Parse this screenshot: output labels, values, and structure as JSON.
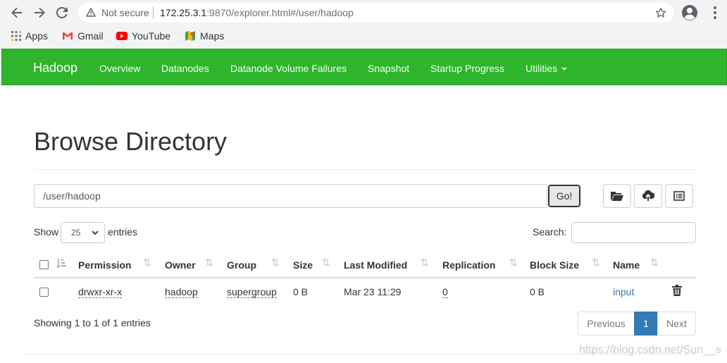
{
  "browser": {
    "security_label": "Not secure",
    "url_host": "172.25.3.1",
    "url_rest": ":9870/explorer.html#/user/hadoop",
    "bookmarks": [
      "Apps",
      "Gmail",
      "YouTube",
      "Maps"
    ]
  },
  "navbar": {
    "brand": "Hadoop",
    "items": [
      "Overview",
      "Datanodes",
      "Datanode Volume Failures",
      "Snapshot",
      "Startup Progress",
      "Utilities"
    ],
    "color": "#2fb52d"
  },
  "page": {
    "title": "Browse Directory",
    "path_value": "/user/hadoop",
    "go_label": "Go!"
  },
  "table_controls": {
    "show_label": "Show",
    "entries_value": "25",
    "entries_label": "entries",
    "search_label": "Search:"
  },
  "table": {
    "columns": [
      "Permission",
      "Owner",
      "Group",
      "Size",
      "Last Modified",
      "Replication",
      "Block Size",
      "Name"
    ],
    "rows": [
      {
        "permission": "drwxr-xr-x",
        "owner": "hadoop",
        "group": "supergroup",
        "size": "0 B",
        "modified": "Mar 23 11:29",
        "replication": "0",
        "block_size": "0 B",
        "name": "input"
      }
    ]
  },
  "pagination": {
    "info": "Showing 1 to 1 of 1 entries",
    "previous": "Previous",
    "current": "1",
    "next": "Next"
  },
  "watermark": "https://blog.csdn.net/Sun__s"
}
